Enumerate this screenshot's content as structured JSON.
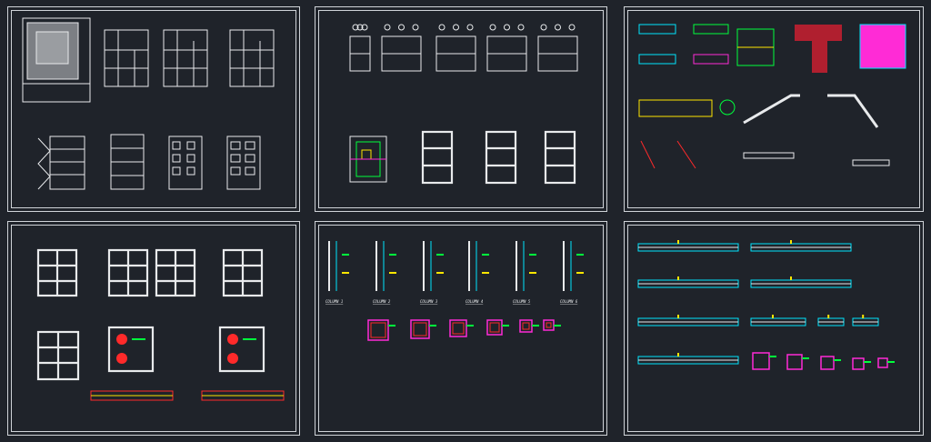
{
  "background_color": "#1f232a",
  "line_color": "#e8eaec",
  "accent_colors": [
    "#00e5ff",
    "#ffe600",
    "#00ff3c",
    "#ff2bd6",
    "#ff2a2a",
    "#b01f2f",
    "#ff9900"
  ],
  "sheets": [
    {
      "id": "architectural-plans-and-elevations"
    },
    {
      "id": "foundation-and-column-layout"
    },
    {
      "id": "stair-and-slab-details"
    },
    {
      "id": "frame-sections"
    },
    {
      "id": "column-schedule"
    },
    {
      "id": "beam-details"
    }
  ],
  "column_labels": [
    "COLUMN 1",
    "COLUMN 2",
    "COLUMN 3",
    "COLUMN 4",
    "COLUMN 5",
    "COLUMN 6"
  ]
}
